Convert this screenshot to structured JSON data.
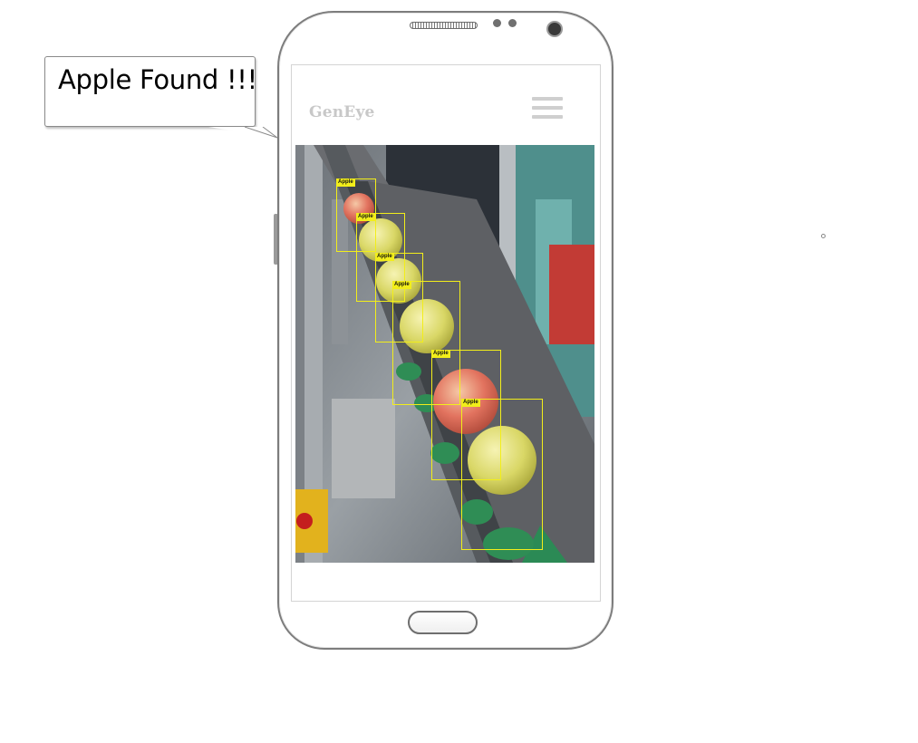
{
  "speech_bubble": {
    "text": "Apple Found !!!"
  },
  "app": {
    "title": "GenEye",
    "menu_icon": "hamburger-menu-icon"
  },
  "photo": {
    "description_icon": "conveyor-apples-photo",
    "detections": [
      {
        "label": "Apple"
      },
      {
        "label": "Apple"
      },
      {
        "label": "Apple"
      },
      {
        "label": "Apple"
      },
      {
        "label": "Apple"
      },
      {
        "label": "Apple"
      }
    ]
  },
  "colors": {
    "detection_box": "#f2ee1a",
    "app_title": "#c8c8c8",
    "phone_border": "#7d7d7d"
  }
}
